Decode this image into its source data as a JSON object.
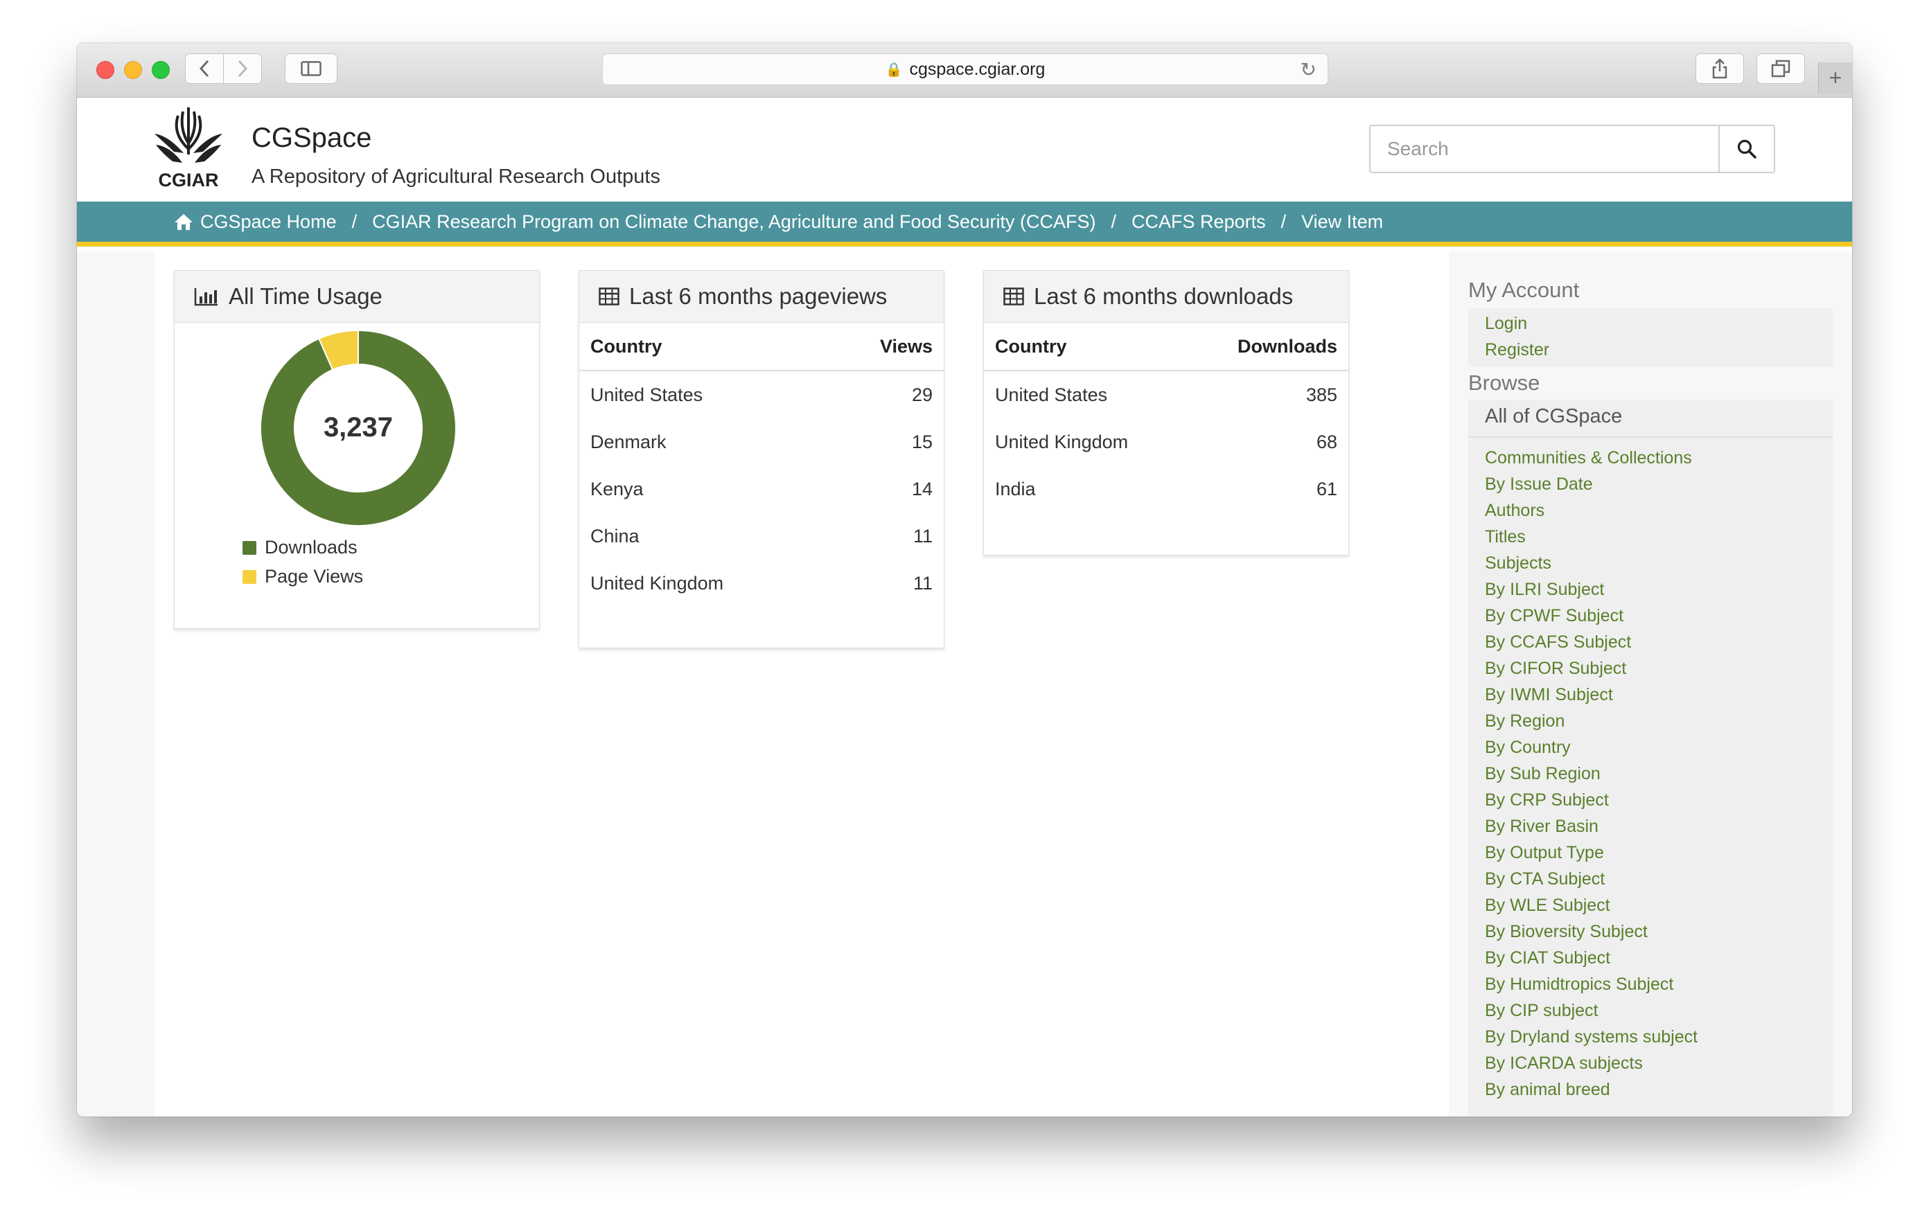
{
  "browser": {
    "url": "cgspace.cgiar.org"
  },
  "site": {
    "logo_text": "CGIAR",
    "title": "CGSpace",
    "subtitle": "A Repository of Agricultural Research Outputs",
    "search_placeholder": "Search"
  },
  "breadcrumb": [
    "CGSpace Home",
    "CGIAR Research Program on Climate Change, Agriculture and Food Security (CCAFS)",
    "CCAFS Reports",
    "View Item"
  ],
  "usage": {
    "title": "All Time Usage",
    "total": "3,237",
    "legend": [
      "Downloads",
      "Page Views"
    ],
    "colors": {
      "downloads": "#577a33",
      "pageviews": "#f4d03f"
    }
  },
  "pageviews": {
    "title": "Last 6 months pageviews",
    "col_country": "Country",
    "col_value": "Views",
    "rows": [
      {
        "country": "United States",
        "value": "29"
      },
      {
        "country": "Denmark",
        "value": "15"
      },
      {
        "country": "Kenya",
        "value": "14"
      },
      {
        "country": "China",
        "value": "11"
      },
      {
        "country": "United Kingdom",
        "value": "11"
      }
    ]
  },
  "downloads": {
    "title": "Last 6 months downloads",
    "col_country": "Country",
    "col_value": "Downloads",
    "rows": [
      {
        "country": "United States",
        "value": "385"
      },
      {
        "country": "United Kingdom",
        "value": "68"
      },
      {
        "country": "India",
        "value": "61"
      }
    ]
  },
  "sidebar": {
    "account_heading": "My Account",
    "account_links": [
      "Login",
      "Register"
    ],
    "browse_heading": "Browse",
    "all_of": "All of CGSpace",
    "browse_links": [
      "Communities & Collections",
      "By Issue Date",
      "Authors",
      "Titles",
      "Subjects",
      "By ILRI Subject",
      "By CPWF Subject",
      "By CCAFS Subject",
      "By CIFOR Subject",
      "By IWMI Subject",
      "By Region",
      "By Country",
      "By Sub Region",
      "By CRP Subject",
      "By River Basin",
      "By Output Type",
      "By CTA Subject",
      "By WLE Subject",
      "By Bioversity Subject",
      "By CIAT Subject",
      "By Humidtropics Subject",
      "By CIP subject",
      "By Dryland systems subject",
      "By ICARDA subjects",
      "By animal breed"
    ]
  },
  "chart_data": {
    "type": "pie",
    "categories": [
      "Downloads",
      "Page Views"
    ],
    "values": [
      3024,
      213
    ],
    "title": "All Time Usage",
    "center_label": "3,237",
    "legend_position": "bottom-left"
  }
}
